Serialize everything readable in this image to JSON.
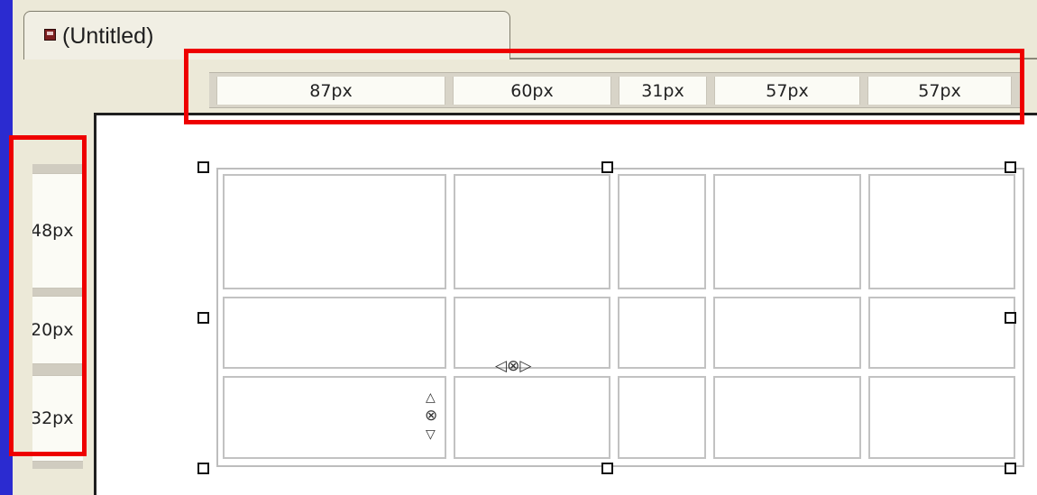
{
  "document": {
    "tab_title": "(Untitled)",
    "tab_icon": "document-icon"
  },
  "column_widths": [
    "87px",
    "60px",
    "31px",
    "57px",
    "57px"
  ],
  "row_heights": [
    "48px",
    "20px",
    "32px"
  ],
  "table": {
    "rows": 3,
    "columns": 5
  },
  "resize_indicators": {
    "column_resize_glyph": "◁⊗▷",
    "row_resize_glyph_top": "△",
    "row_resize_glyph_mid": "⊗",
    "row_resize_glyph_bottom": "▽"
  },
  "colors": {
    "annotation": "#ee0000",
    "background": "#2b2bd0",
    "panel": "#ece9d8"
  }
}
